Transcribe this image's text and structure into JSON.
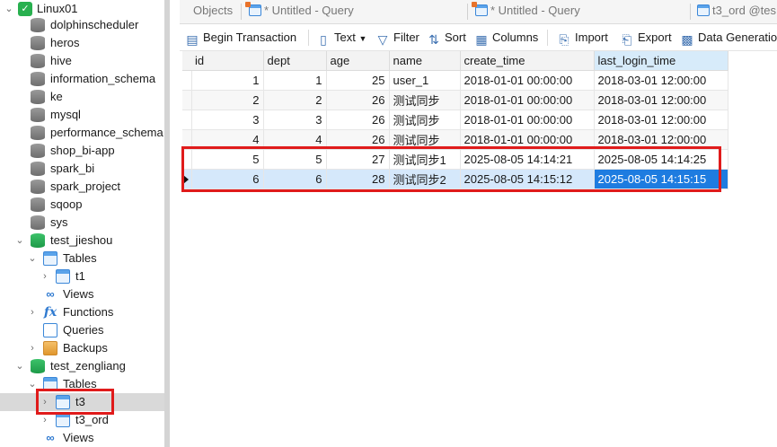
{
  "navigator": {
    "connection": "Linux01",
    "databases": [
      "dolphinscheduler",
      "heros",
      "hive",
      "information_schema",
      "ke",
      "mysql",
      "performance_schema",
      "shop_bi-app",
      "spark_bi",
      "spark_project",
      "sqoop",
      "sys"
    ],
    "test_jieshou": {
      "name": "test_jieshou",
      "tables_label": "Tables",
      "tables": [
        "t1"
      ],
      "views_label": "Views",
      "functions_label": "Functions",
      "queries_label": "Queries",
      "backups_label": "Backups"
    },
    "test_zengliang": {
      "name": "test_zengliang",
      "tables_label": "Tables",
      "tables": [
        "t3",
        "t3_ord"
      ],
      "views_label": "Views"
    }
  },
  "tabs": {
    "objects": "Objects",
    "query1": "* Untitled - Query",
    "query2": "* Untitled - Query",
    "table": "t3_ord @tes"
  },
  "toolbar": {
    "begin_transaction": "Begin Transaction",
    "text": "Text",
    "filter": "Filter",
    "sort": "Sort",
    "columns": "Columns",
    "import": "Import",
    "export": "Export",
    "data_generation": "Data Generation"
  },
  "grid": {
    "columns": [
      "id",
      "dept",
      "age",
      "name",
      "create_time",
      "last_login_time"
    ],
    "rows": [
      [
        "1",
        "1",
        "25",
        "user_1",
        "2018-01-01 00:00:00",
        "2018-03-01 12:00:00"
      ],
      [
        "2",
        "2",
        "26",
        "测试同步",
        "2018-01-01 00:00:00",
        "2018-03-01 12:00:00"
      ],
      [
        "3",
        "3",
        "26",
        "测试同步",
        "2018-01-01 00:00:00",
        "2018-03-01 12:00:00"
      ],
      [
        "4",
        "4",
        "26",
        "测试同步",
        "2018-01-01 00:00:00",
        "2018-03-01 12:00:00"
      ],
      [
        "5",
        "5",
        "27",
        "测试同步1",
        "2025-08-05 14:14:21",
        "2025-08-05 14:14:25"
      ],
      [
        "6",
        "6",
        "28",
        "测试同步2",
        "2025-08-05 14:15:12",
        "2025-08-05 14:15:15"
      ]
    ],
    "selected_row": 6,
    "sorted_column": "last_login_time"
  },
  "colors": {
    "highlight": "#e01b1b",
    "selection": "#1e7ce0",
    "selected_row": "#d5e8fb",
    "db_active": "#28b04f"
  }
}
